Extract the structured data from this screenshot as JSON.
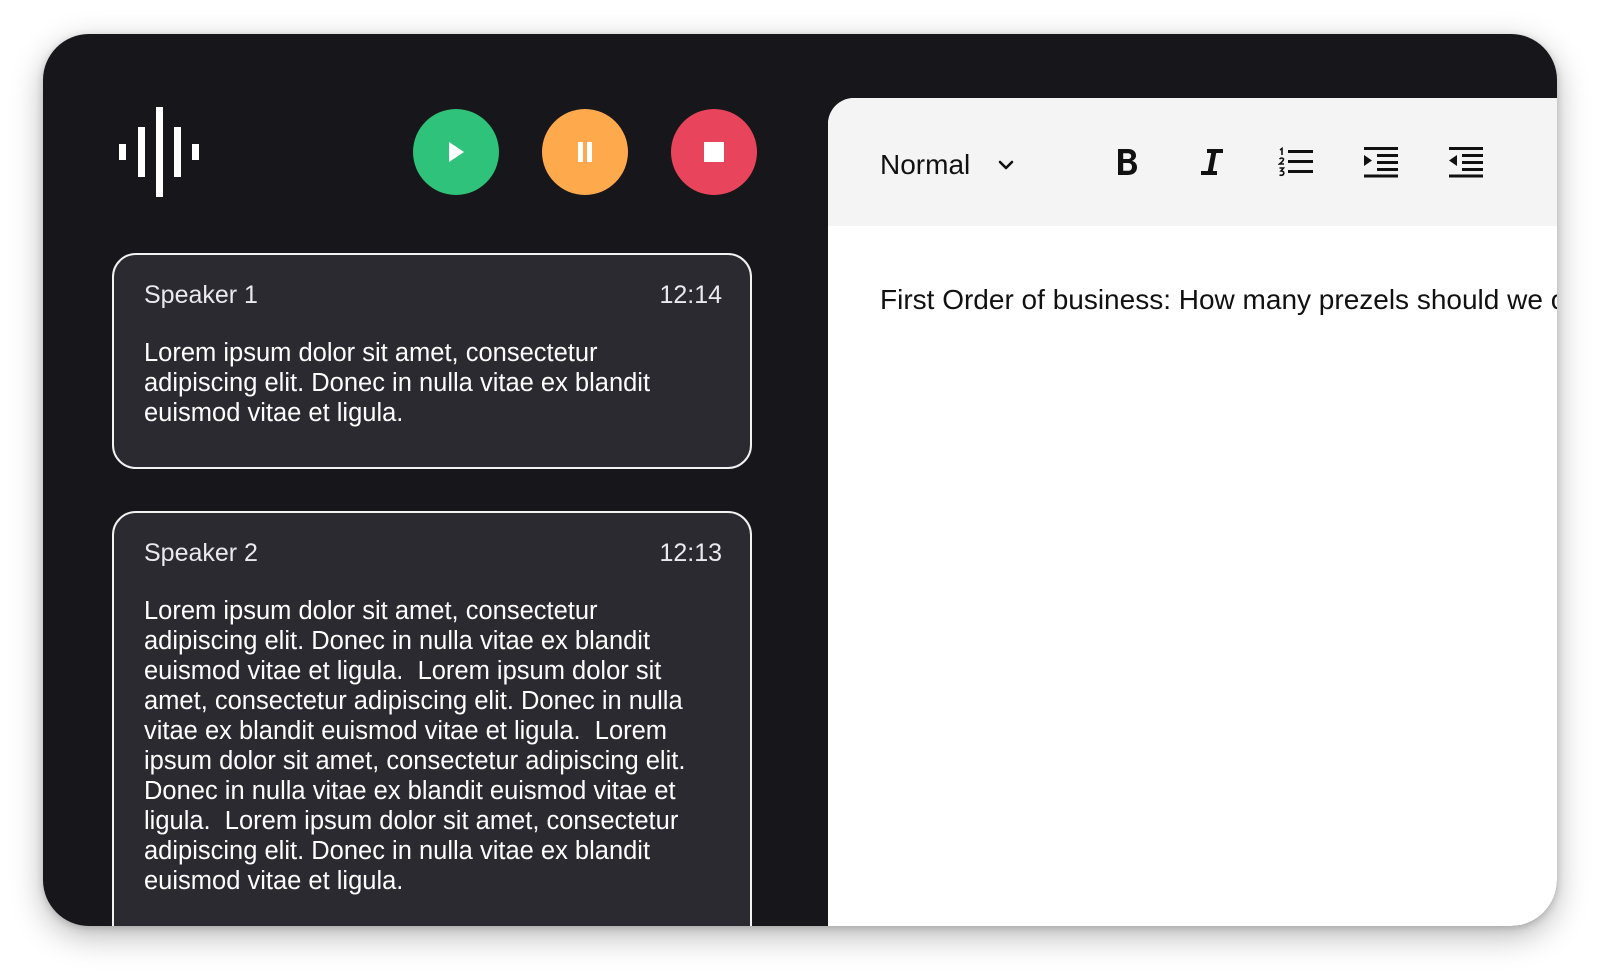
{
  "player": {
    "logo_icon": "waveform-icon",
    "controls": [
      {
        "name": "play",
        "icon": "play-icon",
        "color": "#2ec27a"
      },
      {
        "name": "pause",
        "icon": "pause-icon",
        "color": "#ffa94d"
      },
      {
        "name": "stop",
        "icon": "stop-icon",
        "color": "#e8455c"
      }
    ]
  },
  "transcript": {
    "entries": [
      {
        "speaker": "Speaker 1",
        "time": "12:14",
        "text": "Lorem ipsum dolor sit amet, consectetur\nadipiscing elit. Donec in nulla vitae ex blandit\neuismod vitae et ligula."
      },
      {
        "speaker": "Speaker 2",
        "time": "12:13",
        "text": "Lorem ipsum dolor sit amet, consectetur\nadipiscing elit. Donec in nulla vitae ex blandit\neuismod vitae et ligula.  Lorem ipsum dolor sit\namet, consectetur adipiscing elit. Donec in nulla\nvitae ex blandit euismod vitae et ligula.  Lorem\nipsum dolor sit amet, consectetur adipiscing elit.\nDonec in nulla vitae ex blandit euismod vitae et\nligula.  Lorem ipsum dolor sit amet, consectetur\nadipiscing elit. Donec in nulla vitae ex blandit\neuismod vitae et ligula."
      }
    ]
  },
  "editor": {
    "toolbar": {
      "format_value": "Normal",
      "tools": [
        "bold-icon",
        "italic-icon",
        "ordered-list-icon",
        "indent-icon",
        "outdent-icon"
      ]
    },
    "content": "First Order of business: How many prezels should we order?"
  },
  "colors": {
    "app_background": "#17171b",
    "card_background": "#2a2a30",
    "toolbar_background": "#f4f4f4"
  }
}
